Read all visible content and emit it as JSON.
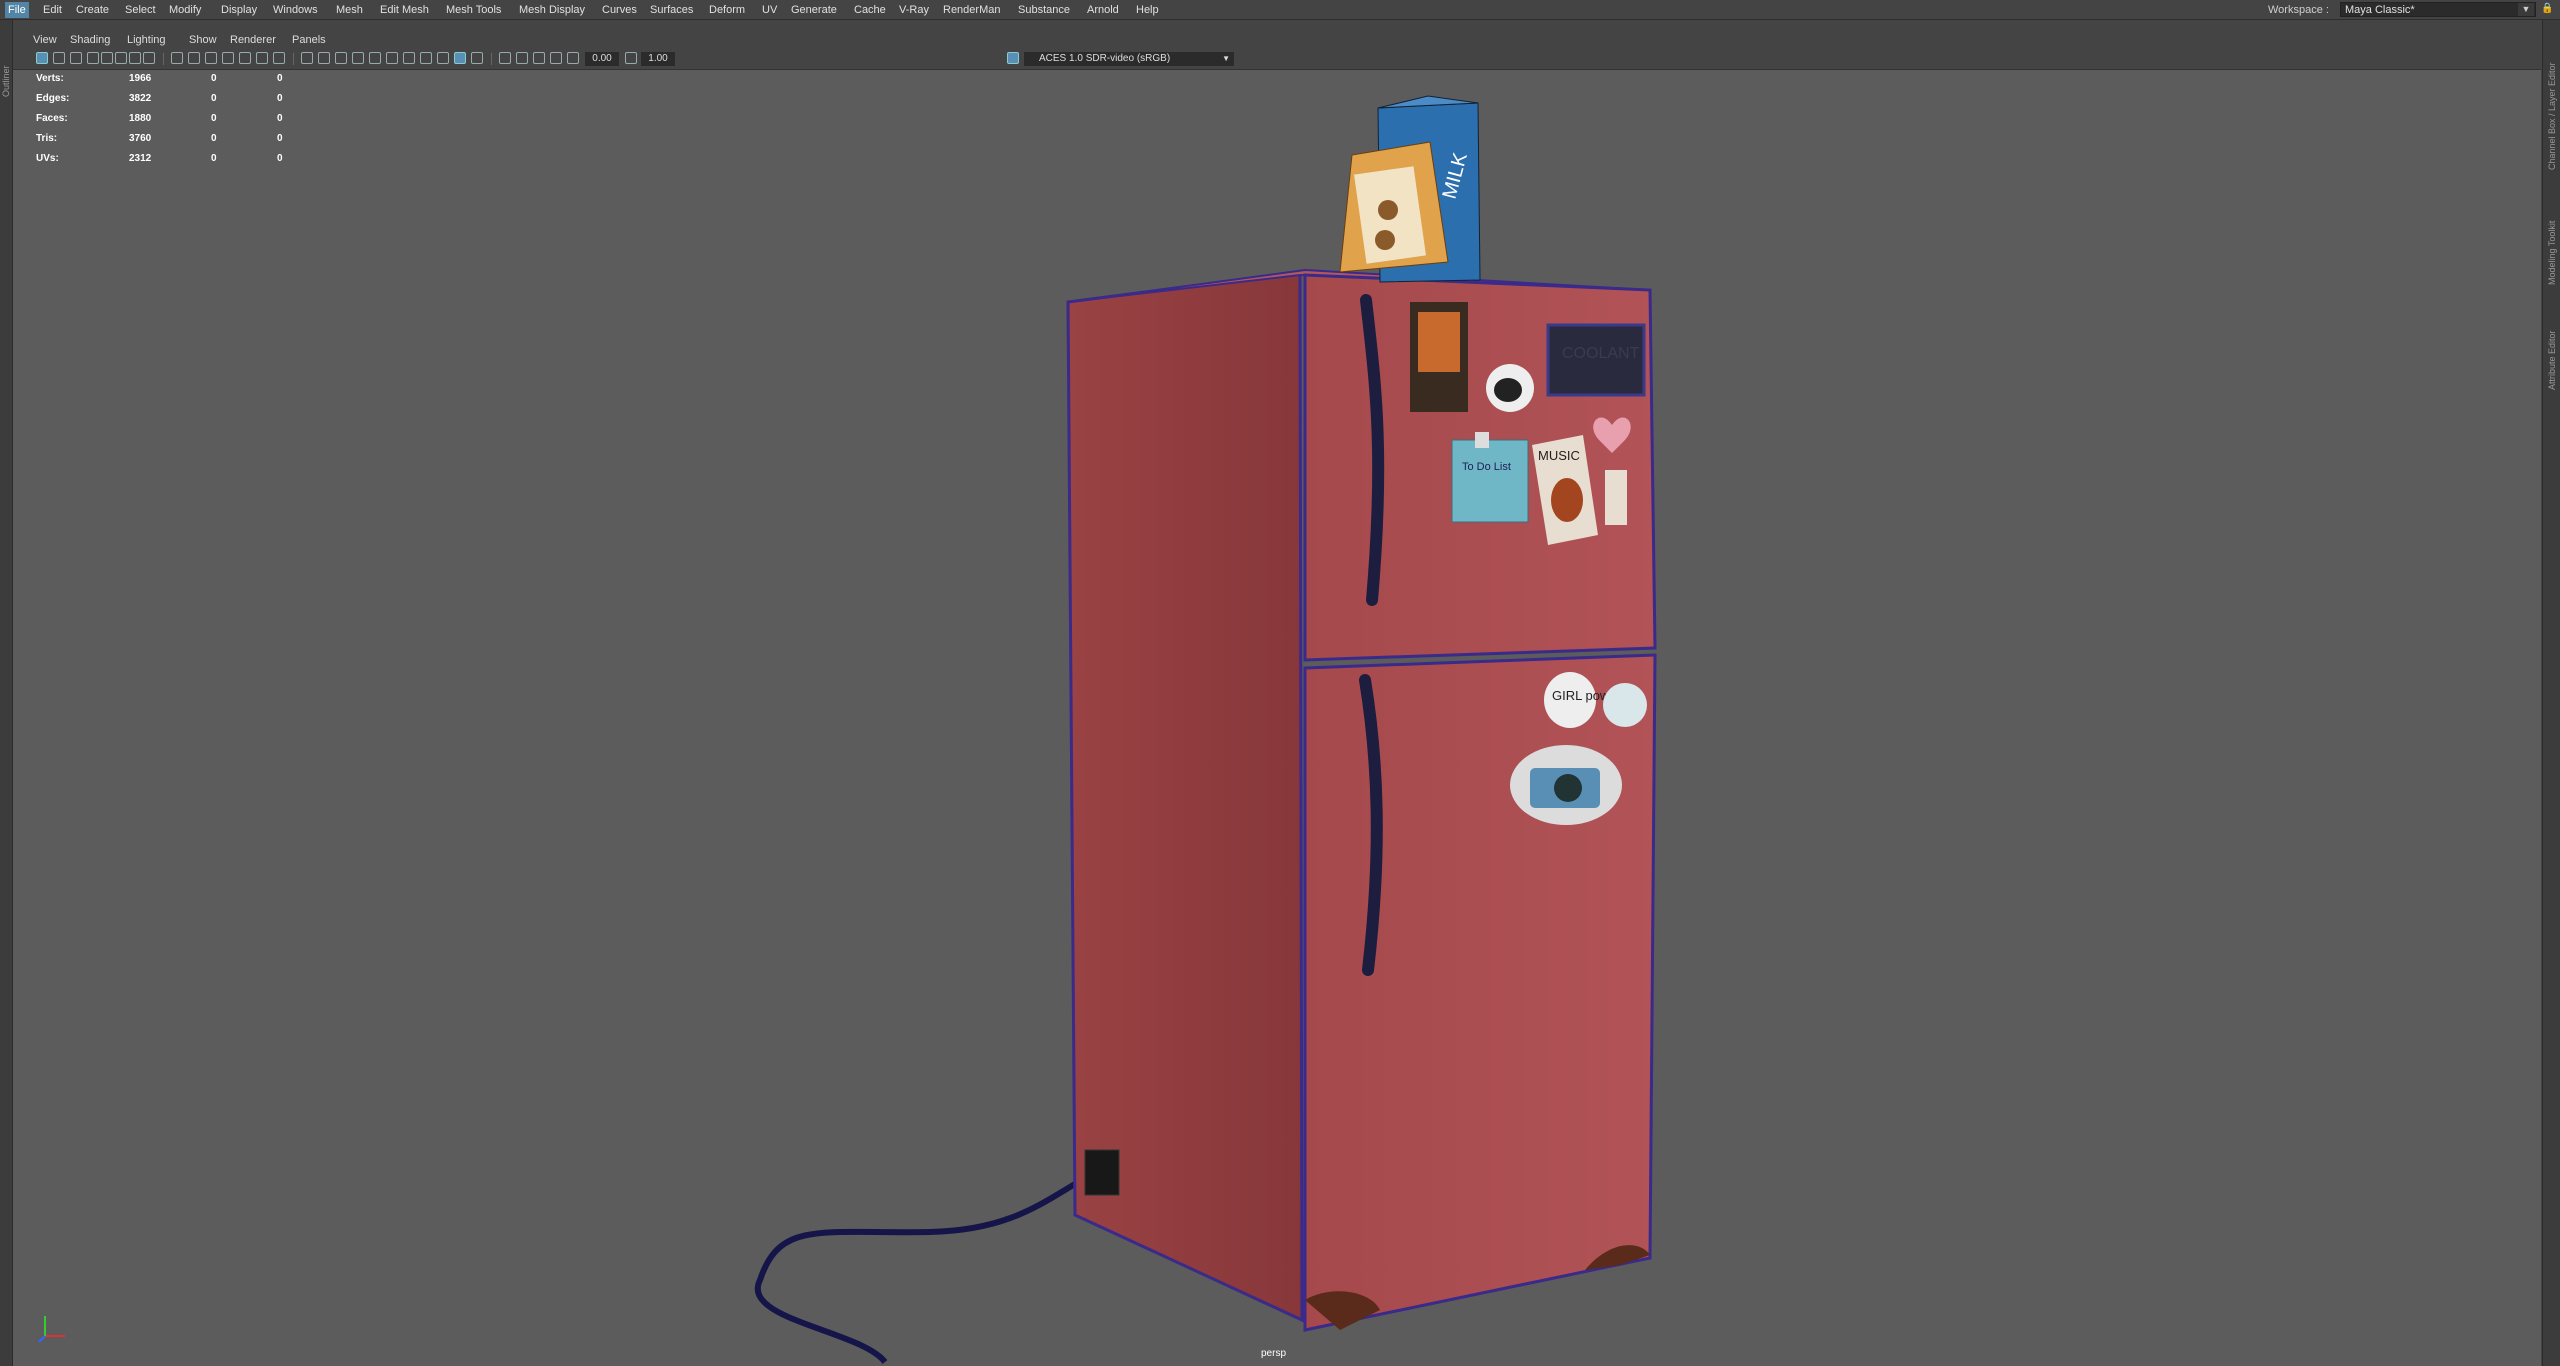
{
  "menubar": {
    "items": [
      "File",
      "Edit",
      "Create",
      "Select",
      "Modify",
      "Display",
      "Windows",
      "Mesh",
      "Edit Mesh",
      "Mesh Tools",
      "Mesh Display",
      "Curves",
      "Surfaces",
      "Deform",
      "UV",
      "Generate",
      "Cache",
      "V-Ray",
      "RenderMan",
      "Substance",
      "Arnold",
      "Help"
    ],
    "active": "File",
    "workspace_label": "Workspace :",
    "workspace_value": "Maya Classic*"
  },
  "left_strip": {
    "label": "Outliner"
  },
  "right_strip": {
    "tabs": [
      "Channel Box / Layer Editor",
      "Modeling Toolkit",
      "Attribute Editor"
    ]
  },
  "panel_menu": {
    "items": [
      "View",
      "Shading",
      "Lighting",
      "Show",
      "Renderer",
      "Panels"
    ]
  },
  "toolbar": {
    "exposure": "0.00",
    "gamma": "1.00",
    "color_space": "ACES 1.0 SDR-video (sRGB)"
  },
  "hud": {
    "rows": [
      {
        "label": "Verts:",
        "v1": "1966",
        "v2": "0",
        "v3": "0"
      },
      {
        "label": "Edges:",
        "v1": "3822",
        "v2": "0",
        "v3": "0"
      },
      {
        "label": "Faces:",
        "v1": "1880",
        "v2": "0",
        "v3": "0"
      },
      {
        "label": "Tris:",
        "v1": "3760",
        "v2": "0",
        "v3": "0"
      },
      {
        "label": "UVs:",
        "v1": "2312",
        "v2": "0",
        "v3": "0"
      }
    ]
  },
  "viewport": {
    "camera": "persp",
    "milk_label": "MILK",
    "coolant_label": "COOLANT",
    "music_label": "MUSIC",
    "girl_label": "GIRL power",
    "todo_label": "To Do List"
  },
  "colors": {
    "menubar_bg": "#444444",
    "viewport_bg": "#5c5c5c",
    "accent": "#5285a6",
    "fridge": "#a0474a"
  }
}
